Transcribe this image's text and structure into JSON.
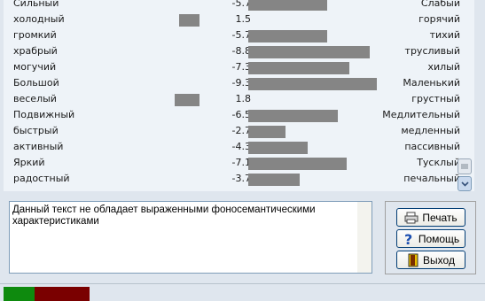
{
  "rows": [
    {
      "left": "Сильный",
      "value": "-5.7",
      "right": "Слабый",
      "level": -5.7
    },
    {
      "left": "холодный",
      "value": "1.5",
      "right": "горячий",
      "level": 1.5
    },
    {
      "left": "громкий",
      "value": "-5.7",
      "right": "тихий",
      "level": -5.7
    },
    {
      "left": "храбрый",
      "value": "-8.8",
      "right": "трусливый",
      "level": -8.8
    },
    {
      "left": "могучий",
      "value": "-7.3",
      "right": "хилый",
      "level": -7.3
    },
    {
      "left": "Большой",
      "value": "-9.3",
      "right": "Маленький",
      "level": -9.3
    },
    {
      "left": "веселый",
      "value": "1.8",
      "right": "грустный",
      "level": 1.8
    },
    {
      "left": "Подвижный",
      "value": "-6.5",
      "right": "Медлительный",
      "level": -6.5
    },
    {
      "left": "быстрый",
      "value": "-2.7",
      "right": "медленный",
      "level": -2.7
    },
    {
      "left": "активный",
      "value": "-4.3",
      "right": "пассивный",
      "level": -4.3
    },
    {
      "left": "Яркий",
      "value": "-7.1",
      "right": "Тусклый",
      "level": -7.1
    },
    {
      "left": "радостный",
      "value": "-3.7",
      "right": "печальный",
      "level": -3.7
    }
  ],
  "message": "Данный текст не обладает выраженными фоносемантическими характеристиками",
  "buttons": {
    "print": "Печать",
    "help": "Помощь",
    "exit": "Выход"
  },
  "colors": {
    "bar": "#858585",
    "status_green": "#0e8a0e",
    "status_red": "#7a0000"
  }
}
